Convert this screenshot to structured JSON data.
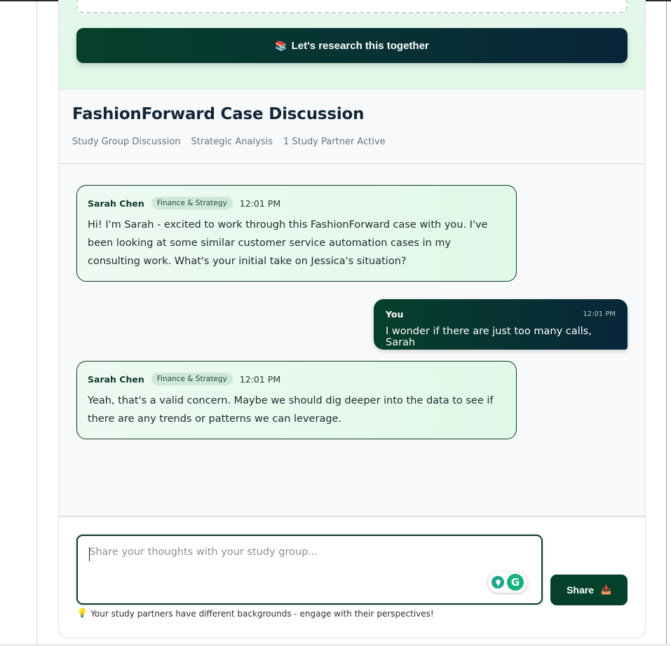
{
  "cta": {
    "label": "Let's research this together",
    "icon": "books-icon"
  },
  "header": {
    "title": "FashionForward Case Discussion",
    "meta": [
      "Study Group Discussion",
      "Strategic Analysis",
      "1 Study Partner Active"
    ]
  },
  "messages": [
    {
      "sender": "Sarah Chen",
      "role": "Finance & Strategy",
      "time": "12:01 PM",
      "text": "Hi! I'm Sarah - excited to work through this FashionForward case with you. I've been looking at some similar customer service automation cases in my consulting work. What's your initial take on Jessica's situation?"
    },
    {
      "sender": "You",
      "time": "12:01 PM",
      "text": "I wonder if there are just too many calls, Sarah"
    },
    {
      "sender": "Sarah Chen",
      "role": "Finance & Strategy",
      "time": "12:01 PM",
      "text": "Yeah, that's a valid concern. Maybe we should dig deeper into the data to see if there are any trends or patterns we can leverage."
    }
  ],
  "composer": {
    "placeholder": "Share your thoughts with your study group...",
    "value": "",
    "share_label": "Share",
    "share_icon": "inbox-tray-icon",
    "tip": "Your study partners have different backgrounds - engage with their perspectives!"
  },
  "colors": {
    "brand_dark_green": "#06402b",
    "brand_dark_blue": "#08263a",
    "bubble_green": "#e0f9e9"
  }
}
